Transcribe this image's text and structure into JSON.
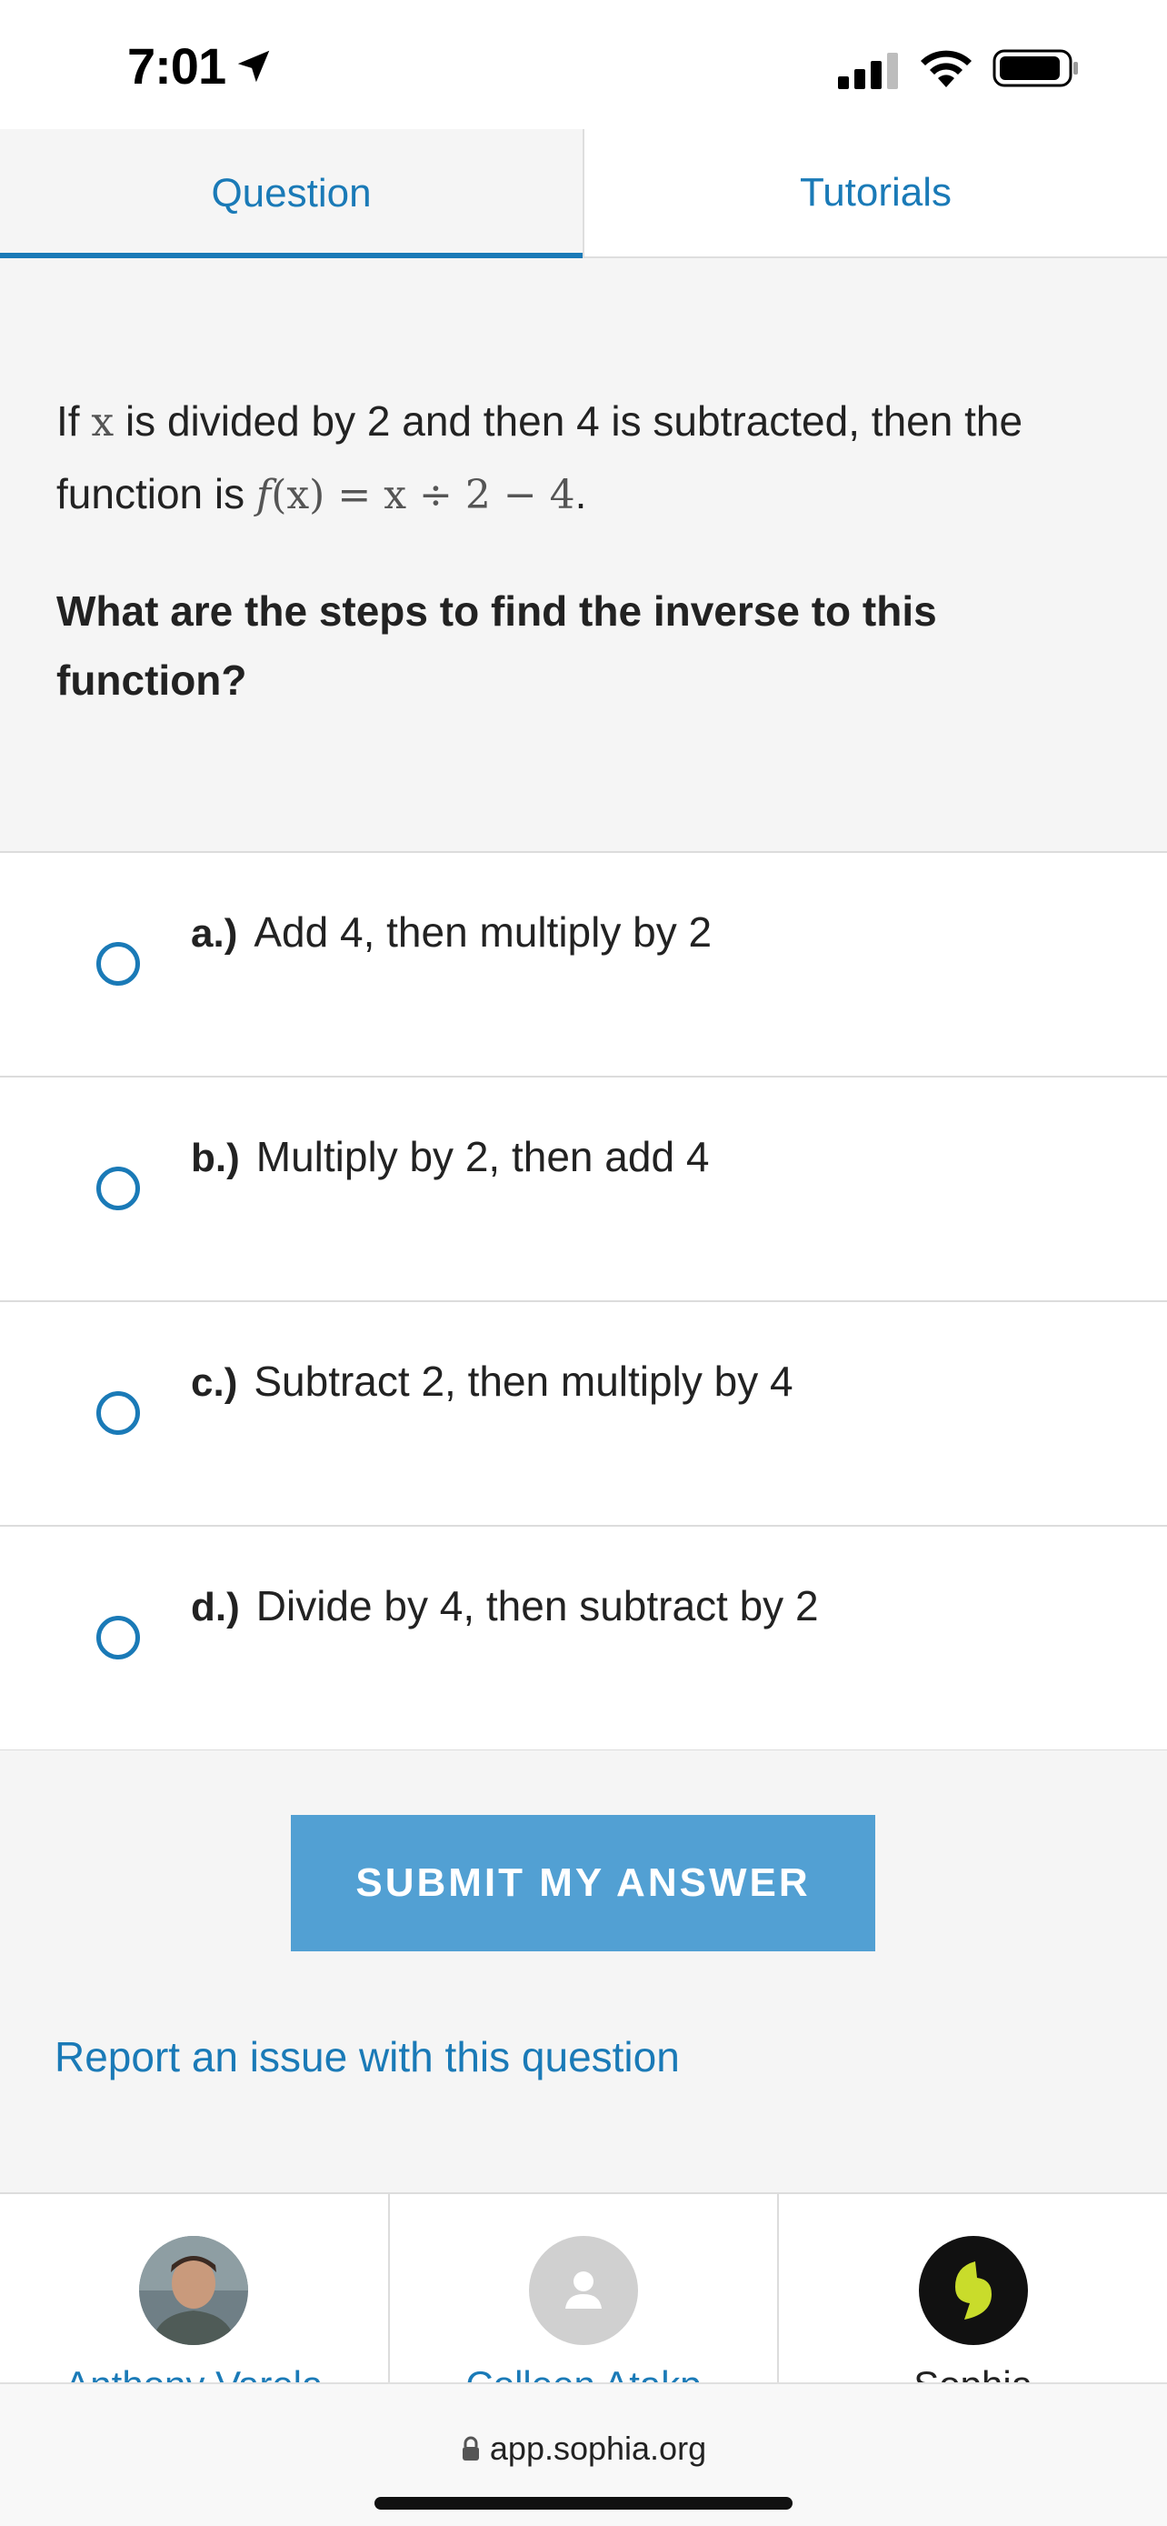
{
  "status_bar": {
    "time": "7:01"
  },
  "tabs": [
    {
      "label": "Question",
      "active": true
    },
    {
      "label": "Tutorials",
      "active": false
    }
  ],
  "question": {
    "prompt_part1": "If ",
    "prompt_var": "x",
    "prompt_part2": " is divided by 2 and then 4 is subtracted, then the function is ",
    "function_expr_f": "f",
    "function_expr_rest": "(x) = x ÷ 2 − 4",
    "prompt_end": ".",
    "ask": "What are the steps to find the inverse to this function?"
  },
  "options": [
    {
      "letter": "a.)",
      "text": "Add 4, then multiply by 2"
    },
    {
      "letter": "b.)",
      "text": "Multiply by 2, then add 4"
    },
    {
      "letter": "c.)",
      "text": "Subtract 2, then multiply by 4"
    },
    {
      "letter": "d.)",
      "text": "Divide by 4, then subtract by 2"
    }
  ],
  "submit_label": "SUBMIT MY ANSWER",
  "report_label": "Report an issue with this question",
  "tutors": [
    {
      "name": "Anthony Varela",
      "icon": "photo-avatar"
    },
    {
      "name": "Colleen Atakp",
      "icon": "default-person-avatar"
    },
    {
      "name": "Sophia",
      "icon": "sophia-logo"
    }
  ],
  "browser": {
    "url": "app.sophia.org"
  },
  "colors": {
    "accent": "#1a7ab7",
    "button": "#52a0d3",
    "panel": "#f5f5f5",
    "sophia_green": "#c9dc2b"
  }
}
